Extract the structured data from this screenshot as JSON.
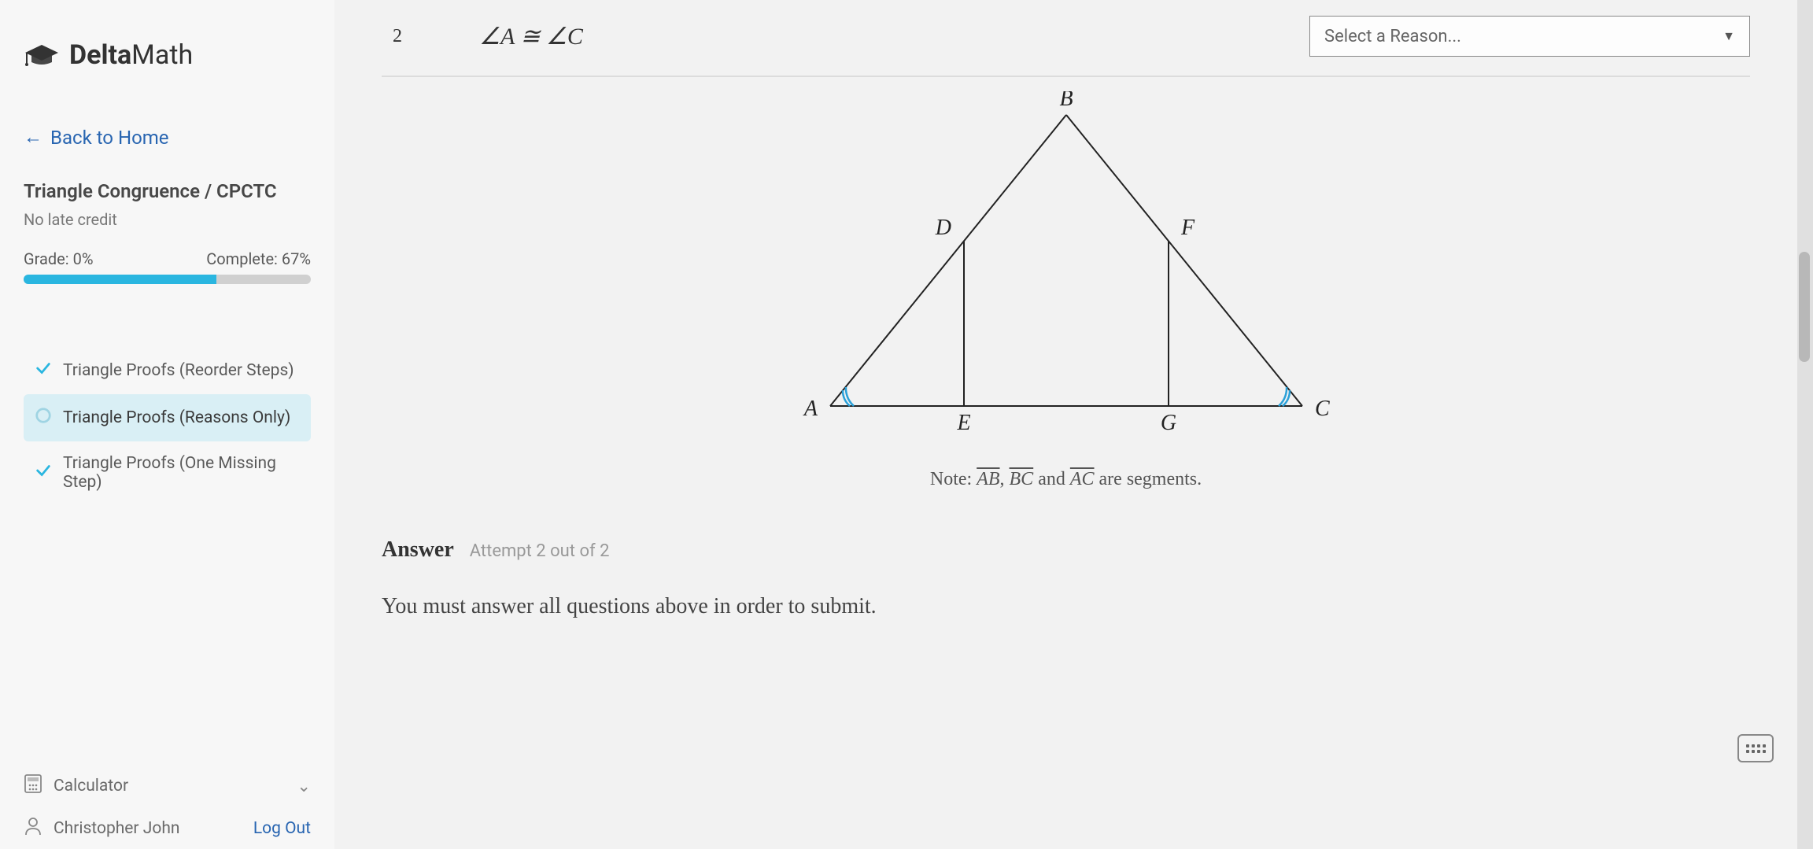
{
  "brand": {
    "delta": "Delta",
    "math": "Math"
  },
  "nav": {
    "back_label": "Back to Home"
  },
  "assignment": {
    "title": "Triangle Congruence / CPCTC",
    "late_credit": "No late credit",
    "grade_label": "Grade: 0%",
    "complete_label": "Complete: 67%",
    "progress_percent": 67
  },
  "topics": [
    {
      "label": "Triangle Proofs (Reorder Steps)",
      "status": "done"
    },
    {
      "label": "Triangle Proofs (Reasons Only)",
      "status": "active"
    },
    {
      "label": "Triangle Proofs (One Missing Step)",
      "status": "done"
    }
  ],
  "footer": {
    "calculator": "Calculator",
    "user_name": "Christopher John",
    "logout": "Log Out"
  },
  "proof": {
    "step_num": "2",
    "statement": "∠A ≅ ∠C",
    "reason_placeholder": "Select a Reason..."
  },
  "figure": {
    "labels": {
      "A": "A",
      "B": "B",
      "C": "C",
      "D": "D",
      "E": "E",
      "F": "F",
      "G": "G"
    },
    "note_prefix": "Note: ",
    "note_seg1": "AB",
    "note_sep1": ", ",
    "note_seg2": "BC",
    "note_sep2": " and ",
    "note_seg3": "AC",
    "note_suffix": " are segments."
  },
  "answer": {
    "heading": "Answer",
    "attempt": "Attempt 2 out of 2",
    "submit_msg": "You must answer all questions above in order to submit."
  }
}
